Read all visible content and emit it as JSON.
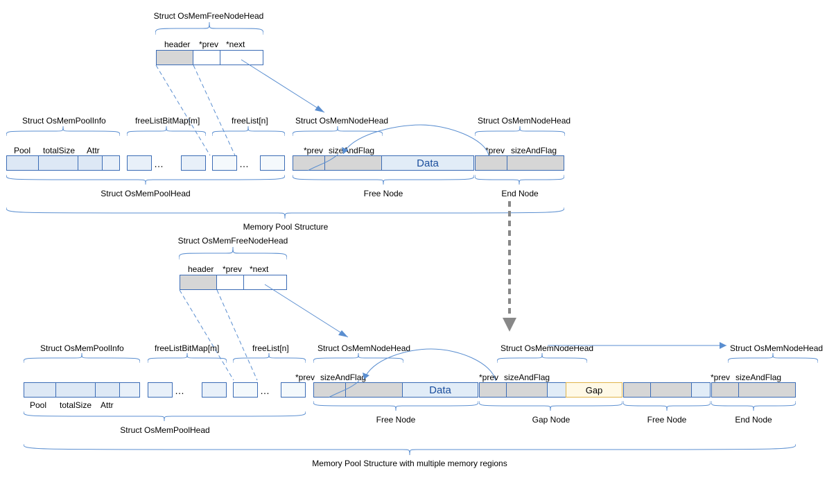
{
  "type": "diagram",
  "diagram": {
    "title_top": "Memory Pool Structure",
    "title_bottom": "Memory Pool Structure with multiple memory regions",
    "freeNodeHead": {
      "title": "Struct OsMemFreeNodeHead",
      "fields": {
        "header": "header",
        "prev": "*prev",
        "next": "*next"
      }
    },
    "poolRow": {
      "poolInfo_title": "Struct OsMemPoolInfo",
      "poolInfo_fields": {
        "pool": "Pool",
        "totalSize": "totalSize",
        "attr": "Attr"
      },
      "freeListBitMap": "freeListBitMap[m]",
      "freeList": "freeList[n]",
      "poolHead_title": "Struct OsMemPoolHead"
    },
    "nodeHead": {
      "title": "Struct OsMemNodeHead",
      "fields": {
        "prev": "*prev",
        "sizeAndFlag": "sizeAndFlag"
      }
    },
    "data": "Data",
    "gap": "Gap",
    "roles": {
      "freeNode": "Free Node",
      "endNode": "End Node",
      "gapNode": "Gap Node"
    }
  }
}
